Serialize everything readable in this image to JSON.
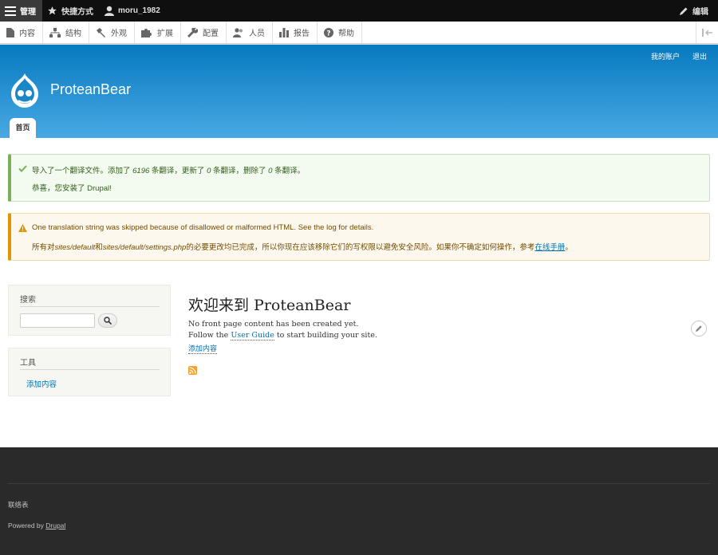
{
  "toolbar": {
    "manage_label": "管理",
    "shortcuts_label": "快捷方式",
    "user_label": "moru_1982",
    "edit_label": "编辑"
  },
  "tray": {
    "items": [
      {
        "label": "内容",
        "icon": "file-icon"
      },
      {
        "label": "结构",
        "icon": "sitemap-icon"
      },
      {
        "label": "外观",
        "icon": "brush-icon"
      },
      {
        "label": "扩展",
        "icon": "puzzle-icon"
      },
      {
        "label": "配置",
        "icon": "wrench-icon"
      },
      {
        "label": "人员",
        "icon": "people-icon"
      },
      {
        "label": "报告",
        "icon": "bar-chart-icon"
      },
      {
        "label": "帮助",
        "icon": "help-icon"
      }
    ]
  },
  "header": {
    "secondary_menu": [
      "我的账户",
      "退出"
    ],
    "site_name": "ProteanBear",
    "primary_tab": "首页"
  },
  "messages": {
    "status": {
      "line1_a": "导入了一个翻译文件。添加了 ",
      "line1_b": "6196",
      "line1_c": " 条翻译，更新了 ",
      "line1_d": "0",
      "line1_e": " 条翻译，删除了 ",
      "line1_f": "0",
      "line1_g": " 条翻译。",
      "line2": "恭喜，您安装了 Drupal!"
    },
    "warning": {
      "line1": "One translation string was skipped because of disallowed or malformed HTML. See the log for details.",
      "line2_a": "所有对",
      "line2_b": "sites/default",
      "line2_c": "和",
      "line2_d": "sites/default/settings.php",
      "line2_e": "的必要更改均已完成，所以你现在应该移除它们的写权限以避免安全风险。如果你不确定如何操作，参考",
      "line2_link": "在线手册",
      "line2_f": "。"
    }
  },
  "sidebar": {
    "search_title": "搜索",
    "search_value": "",
    "tools_title": "工具",
    "tools_link": "添加内容"
  },
  "main": {
    "title": "欢迎来到 ProteanBear",
    "line1": "No front page content has been created yet.",
    "line2_a": "Follow the ",
    "line2_link": "User Guide",
    "line2_b": " to start building your site.",
    "add_content": "添加内容"
  },
  "footer": {
    "contact": "联络表",
    "powered_by": "Powered by ",
    "drupal_link": "Drupal"
  }
}
